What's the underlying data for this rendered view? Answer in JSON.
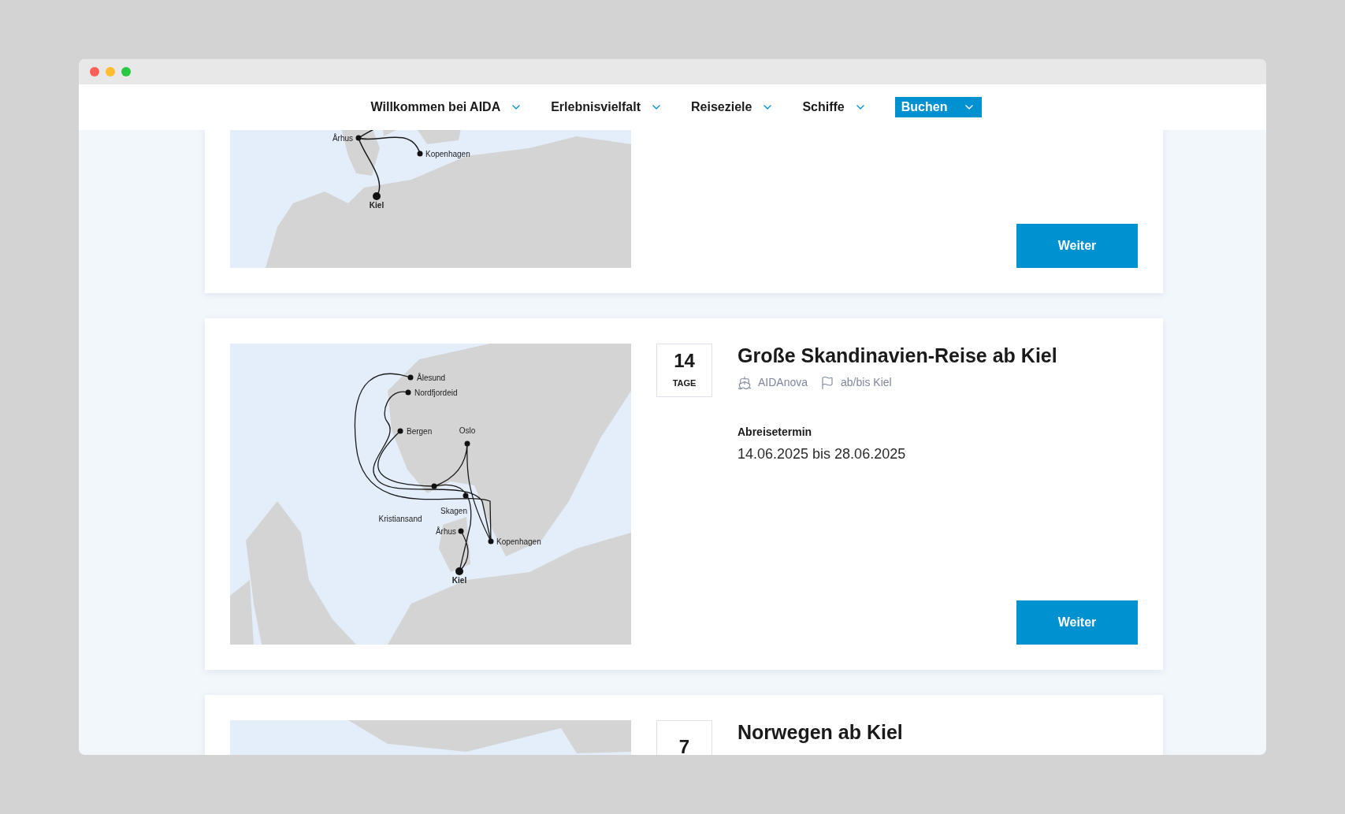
{
  "nav": {
    "items": [
      {
        "label": "Willkommen bei AIDA",
        "kind": "menu"
      },
      {
        "label": "Erlebnisvielfalt",
        "kind": "menu"
      },
      {
        "label": "Reiseziele",
        "kind": "menu"
      },
      {
        "label": "Schiffe",
        "kind": "menu"
      },
      {
        "label": "Buchen",
        "kind": "cta"
      }
    ]
  },
  "cruises": [
    {
      "map": {
        "kind": "denmark",
        "ports": [
          {
            "name": "Århus",
            "home": false
          },
          {
            "name": "Kopenhagen",
            "home": false
          },
          {
            "name": "Kiel",
            "home": true
          }
        ]
      },
      "button": "Weiter"
    },
    {
      "days": "14",
      "days_label": "TAGE",
      "title": "Große Skandinavien-Reise ab Kiel",
      "ship": "AIDAnova",
      "route": "ab/bis Kiel",
      "date_label": "Abreisetermin",
      "date": "14.06.2025 bis 28.06.2025",
      "map": {
        "kind": "scandinavia",
        "ports": [
          {
            "name": "Ålesund",
            "home": false
          },
          {
            "name": "Nordfjordeid",
            "home": false
          },
          {
            "name": "Bergen",
            "home": false
          },
          {
            "name": "Oslo",
            "home": false
          },
          {
            "name": "Kristiansand",
            "home": false
          },
          {
            "name": "Skagen",
            "home": false
          },
          {
            "name": "Århus",
            "home": false
          },
          {
            "name": "Kopenhagen",
            "home": false
          },
          {
            "name": "Kiel",
            "home": true
          }
        ]
      },
      "button": "Weiter"
    },
    {
      "days": "7",
      "title": "Norwegen ab Kiel",
      "map": {
        "kind": "norway"
      }
    }
  ]
}
